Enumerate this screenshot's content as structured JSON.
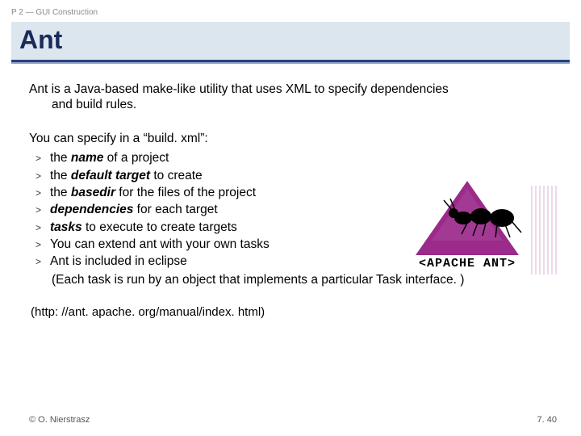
{
  "breadcrumb": "P 2 — GUI Construction",
  "title": "Ant",
  "intro_line1": "Ant is a Java-based make-like utility that uses XML to specify dependencies",
  "intro_line2": "and build rules.",
  "spec_title": "You can specify in a “build. xml”:",
  "bullets": [
    {
      "pre": "the ",
      "em": "name",
      "post": " of a project",
      "italic": true
    },
    {
      "pre": "the ",
      "em": "default target",
      "post": " to create",
      "italic": true
    },
    {
      "pre": "the ",
      "em": "basedir",
      "post": " for the files of the project",
      "italic": true
    },
    {
      "pre": "",
      "em": "dependencies",
      "post": " for each target",
      "italic": true
    },
    {
      "pre": "",
      "em": "tasks",
      "post": " to execute to create targets",
      "italic": true
    },
    {
      "pre": "",
      "em": "",
      "post": "You can extend ant with your own tasks",
      "italic": false
    },
    {
      "pre": "",
      "em": "",
      "post": "Ant is included in eclipse",
      "italic": false
    }
  ],
  "note": "(Each task is run by an object that implements a particular Task interface. )",
  "url": "(http: //ant. apache. org/manual/index. html)",
  "copyright": "© O. Nierstrasz",
  "page_number": "7. 40",
  "logo_text": "<APACHE ANT>"
}
